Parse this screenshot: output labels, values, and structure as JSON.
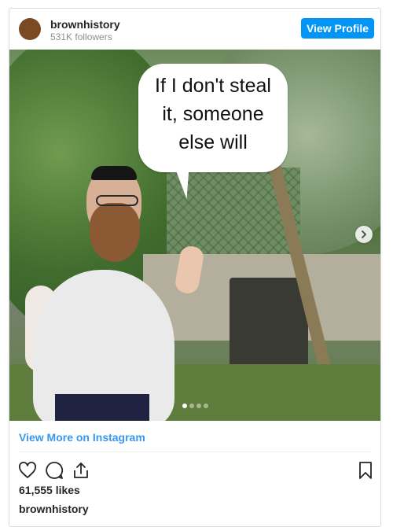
{
  "header": {
    "username": "brownhistory",
    "followers": "531K followers",
    "view_profile_label": "View Profile",
    "avatar_color": "#7a4a25"
  },
  "media": {
    "speech_bubble_line_1": "If I don't steal",
    "speech_bubble_line_2": "it, someone",
    "speech_bubble_line_3": "else will",
    "carousel_dots": 4,
    "active_dot": 0
  },
  "footer": {
    "view_more_label": "View More on Instagram",
    "likes": "61,555 likes",
    "caption_username": "brownhistory"
  },
  "icons": {
    "like": "heart-icon",
    "comment": "comment-icon",
    "share": "share-icon",
    "save": "bookmark-icon",
    "next": "chevron-right-icon"
  },
  "colors": {
    "accent": "#0095f6",
    "link": "#3897f0"
  }
}
